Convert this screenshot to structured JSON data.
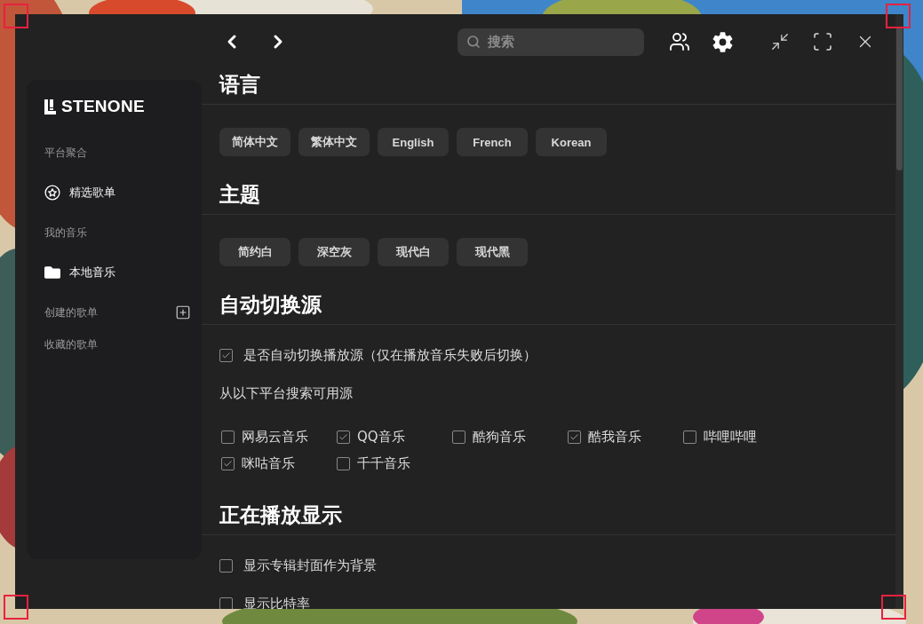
{
  "toolbar": {
    "search": {
      "placeholder": "搜索"
    }
  },
  "sidebar": {
    "logo": "STENONE",
    "sections": [
      {
        "title": "平台聚合",
        "items": [
          {
            "label": "精选歌单"
          }
        ]
      },
      {
        "title": "我的音乐",
        "items": [
          {
            "label": "本地音乐"
          }
        ]
      },
      {
        "title": "创建的歌单"
      },
      {
        "title": "收藏的歌单"
      }
    ]
  },
  "settings": [
    {
      "title": "语言",
      "blocks": [
        {
          "kind": "pills",
          "items": [
            "简体中文",
            "繁体中文",
            "English",
            "French",
            "Korean"
          ]
        }
      ]
    },
    {
      "title": "主题",
      "blocks": [
        {
          "kind": "pills",
          "items": [
            "简约白",
            "深空灰",
            "现代白",
            "现代黑"
          ]
        }
      ]
    },
    {
      "title": "自动切换源",
      "blocks": [
        {
          "kind": "checks",
          "items": [
            {
              "label": "是否自动切换播放源（仅在播放音乐失败后切换）",
              "checked": true
            }
          ]
        },
        {
          "kind": "note",
          "text": "从以下平台搜索可用源"
        },
        {
          "kind": "grid",
          "items": [
            {
              "label": "网易云音乐",
              "checked": false
            },
            {
              "label": "QQ音乐",
              "checked": true
            },
            {
              "label": "酷狗音乐",
              "checked": false
            },
            {
              "label": "酷我音乐",
              "checked": true
            },
            {
              "label": "哔哩哔哩",
              "checked": false
            },
            {
              "label": "咪咕音乐",
              "checked": true
            },
            {
              "label": "千千音乐",
              "checked": false
            }
          ]
        }
      ]
    },
    {
      "title": "正在播放显示",
      "blocks": [
        {
          "kind": "checks",
          "items": [
            {
              "label": "显示专辑封面作为背景",
              "checked": false
            },
            {
              "label": "显示比特率",
              "checked": false
            }
          ]
        }
      ]
    }
  ]
}
